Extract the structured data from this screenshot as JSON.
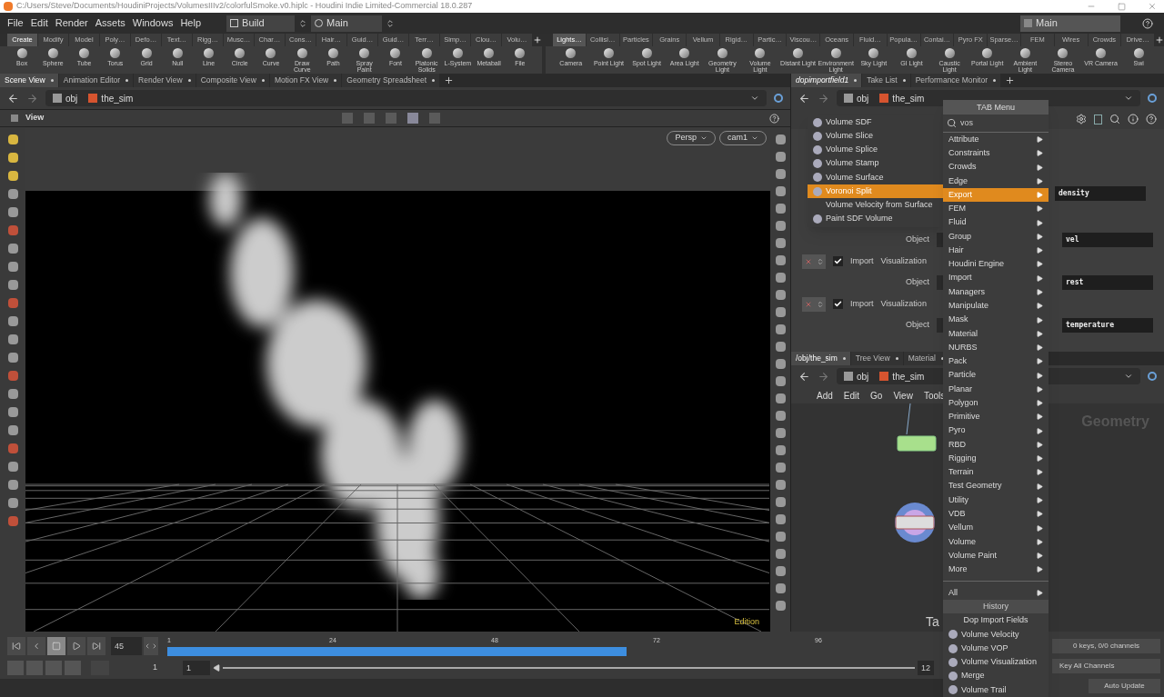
{
  "window": {
    "title": "C:/Users/Steve/Documents/HoudiniProjects/VolumesIIIv2/colorfulSmoke.v0.hiplc - Houdini Indie Limited-Commercial 18.0.287"
  },
  "menu_bar": [
    "File",
    "Edit",
    "Render",
    "Assets",
    "Windows",
    "Help"
  ],
  "desktop": "Build",
  "context": "Main",
  "right_context": "Main",
  "shelf_left": {
    "tabs": [
      {
        "label": "Create",
        "selected": true
      },
      {
        "label": "Modify",
        "selected": false
      },
      {
        "label": "Model",
        "selected": false
      },
      {
        "label": "Poly…",
        "selected": false
      },
      {
        "label": "Defo…",
        "selected": false
      },
      {
        "label": "Text…",
        "selected": false
      },
      {
        "label": "Rigg…",
        "selected": false
      },
      {
        "label": "Musc…",
        "selected": false
      },
      {
        "label": "Char…",
        "selected": false
      },
      {
        "label": "Cons…",
        "selected": false
      },
      {
        "label": "Hair…",
        "selected": false
      },
      {
        "label": "Guid…",
        "selected": false
      },
      {
        "label": "Guid…",
        "selected": false
      },
      {
        "label": "Terr…",
        "selected": false
      },
      {
        "label": "Simp…",
        "selected": false
      },
      {
        "label": "Clou…",
        "selected": false
      },
      {
        "label": "Volu…",
        "selected": false
      }
    ],
    "tools": [
      "Box",
      "Sphere",
      "Tube",
      "Torus",
      "Grid",
      "Null",
      "Line",
      "Circle",
      "Curve",
      "Draw Curve",
      "Path",
      "Spray Paint",
      "Font",
      "Platonic Solids",
      "L-System",
      "Metaball",
      "File"
    ]
  },
  "shelf_right": {
    "tabs": [
      {
        "label": "Lights…",
        "selected": true
      },
      {
        "label": "Collisi…",
        "selected": false
      },
      {
        "label": "Particles",
        "selected": false
      },
      {
        "label": "Grains",
        "selected": false
      },
      {
        "label": "Vellum",
        "selected": false
      },
      {
        "label": "Rigid…",
        "selected": false
      },
      {
        "label": "Partic…",
        "selected": false
      },
      {
        "label": "Viscou…",
        "selected": false
      },
      {
        "label": "Oceans",
        "selected": false
      },
      {
        "label": "Fluid…",
        "selected": false
      },
      {
        "label": "Popula…",
        "selected": false
      },
      {
        "label": "Contai…",
        "selected": false
      },
      {
        "label": "Pyro FX",
        "selected": false
      },
      {
        "label": "Sparse…",
        "selected": false
      },
      {
        "label": "FEM",
        "selected": false
      },
      {
        "label": "Wires",
        "selected": false
      },
      {
        "label": "Crowds",
        "selected": false
      },
      {
        "label": "Drive…",
        "selected": false
      }
    ],
    "tools": [
      "Camera",
      "Point Light",
      "Spot Light",
      "Area Light",
      "Geometry Light",
      "Volume Light",
      "Distant Light",
      "Environment Light",
      "Sky Light",
      "GI Light",
      "Caustic Light",
      "Portal Light",
      "Ambient Light",
      "Stereo Camera",
      "VR Camera",
      "Swi"
    ]
  },
  "scene_pane": {
    "tabs": [
      {
        "label": "Scene View",
        "selected": true
      },
      {
        "label": "Animation Editor",
        "selected": false
      },
      {
        "label": "Render View",
        "selected": false
      },
      {
        "label": "Composite View",
        "selected": false
      },
      {
        "label": "Motion FX View",
        "selected": false
      },
      {
        "label": "Geometry Spreadsheet",
        "selected": false
      }
    ],
    "path": [
      "obj",
      "the_sim"
    ],
    "viewer_label": "View",
    "view_buttons": [
      "Persp",
      "cam1"
    ],
    "edition_text": "Edition"
  },
  "param_pane": {
    "tabs": [
      {
        "label": "dopimportfield1",
        "selected": true
      },
      {
        "label": "Take List",
        "selected": false
      },
      {
        "label": "Performance Monitor",
        "selected": false
      }
    ],
    "path": [
      "obj",
      "the_sim"
    ],
    "rows": [
      {
        "kind": "field",
        "value": "density"
      },
      {
        "kind": "object",
        "label": "Object",
        "value": "vel"
      },
      {
        "kind": "import",
        "checked": true,
        "label": "Import",
        "vis_label": "Visualization"
      },
      {
        "kind": "object",
        "label": "Object",
        "value": "rest"
      },
      {
        "kind": "import",
        "checked": true,
        "label": "Import",
        "vis_label": "Visualization"
      },
      {
        "kind": "object",
        "label": "Object",
        "value": "temperature"
      }
    ]
  },
  "network_pane": {
    "tabs": [
      {
        "label": "/obj/the_sim",
        "selected": true
      },
      {
        "label": "Tree View",
        "selected": false
      },
      {
        "label": "Material",
        "selected": false
      }
    ],
    "path": [
      "obj",
      "the_sim"
    ],
    "menu": [
      "Add",
      "Edit",
      "Go",
      "View",
      "Tools"
    ],
    "context_label": "Geometry",
    "cut_label": "Ta"
  },
  "search_results": [
    {
      "label": "Volume SDF",
      "selected": false
    },
    {
      "label": "Volume Slice",
      "selected": false
    },
    {
      "label": "Volume Splice",
      "selected": false
    },
    {
      "label": "Volume Stamp",
      "selected": false
    },
    {
      "label": "Volume Surface",
      "selected": false
    },
    {
      "label": "Voronoi Split",
      "selected": true
    },
    {
      "label": "Volume Velocity from Surface",
      "selected": false
    },
    {
      "label": "Paint SDF Volume",
      "selected": false
    }
  ],
  "tab_menu": {
    "title": "TAB Menu",
    "search": "vos",
    "categories": [
      {
        "label": "Attribute",
        "selected": false
      },
      {
        "label": "Constraints",
        "selected": false
      },
      {
        "label": "Crowds",
        "selected": false
      },
      {
        "label": "Edge",
        "selected": false
      },
      {
        "label": "Export",
        "selected": true
      },
      {
        "label": "FEM",
        "selected": false
      },
      {
        "label": "Fluid",
        "selected": false
      },
      {
        "label": "Group",
        "selected": false
      },
      {
        "label": "Hair",
        "selected": false
      },
      {
        "label": "Houdini Engine",
        "selected": false
      },
      {
        "label": "Import",
        "selected": false
      },
      {
        "label": "Managers",
        "selected": false
      },
      {
        "label": "Manipulate",
        "selected": false
      },
      {
        "label": "Mask",
        "selected": false
      },
      {
        "label": "Material",
        "selected": false
      },
      {
        "label": "NURBS",
        "selected": false
      },
      {
        "label": "Pack",
        "selected": false
      },
      {
        "label": "Particle",
        "selected": false
      },
      {
        "label": "Planar",
        "selected": false
      },
      {
        "label": "Polygon",
        "selected": false
      },
      {
        "label": "Primitive",
        "selected": false
      },
      {
        "label": "Pyro",
        "selected": false
      },
      {
        "label": "RBD",
        "selected": false
      },
      {
        "label": "Rigging",
        "selected": false
      },
      {
        "label": "Terrain",
        "selected": false
      },
      {
        "label": "Test Geometry",
        "selected": false
      },
      {
        "label": "Utility",
        "selected": false
      },
      {
        "label": "VDB",
        "selected": false
      },
      {
        "label": "Vellum",
        "selected": false
      },
      {
        "label": "Volume",
        "selected": false
      },
      {
        "label": "Volume Paint",
        "selected": false
      },
      {
        "label": "More",
        "selected": false
      }
    ],
    "all": "All",
    "history_title": "History",
    "history": [
      {
        "label": "Dop Import Fields",
        "kind": "plain"
      },
      {
        "label": "Volume Velocity",
        "kind": "node"
      },
      {
        "label": "Volume VOP",
        "kind": "node"
      },
      {
        "label": "Volume Visualization",
        "kind": "node"
      },
      {
        "label": "Merge",
        "kind": "node"
      },
      {
        "label": "Volume Trail",
        "kind": "node"
      }
    ]
  },
  "timeline": {
    "frame": "45",
    "ticks": [
      "1",
      "24",
      "48",
      "72",
      "96"
    ],
    "start": "1",
    "start2": "1",
    "end": "12",
    "keys": "0 keys, 0/0 channels",
    "key_all": "Key All Channels",
    "update": "Auto Update"
  }
}
